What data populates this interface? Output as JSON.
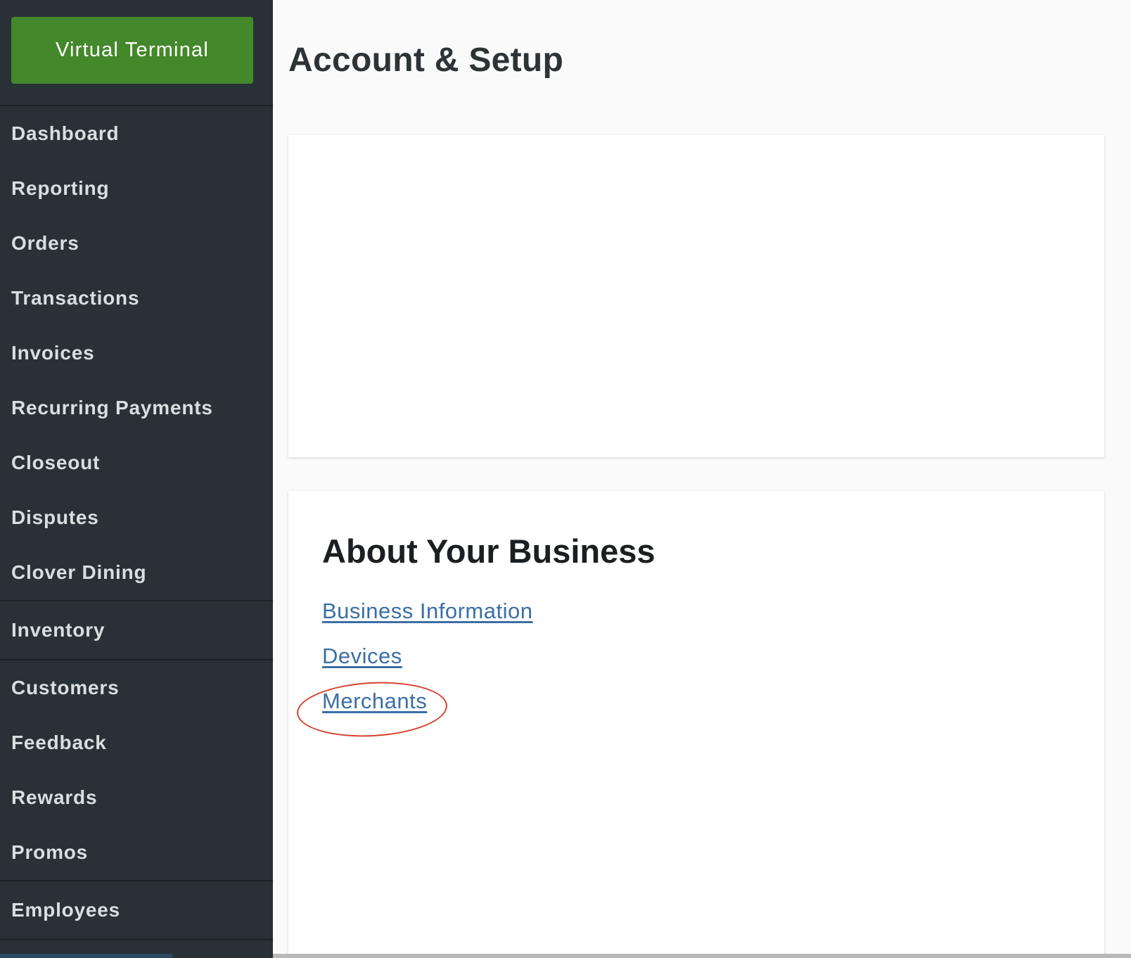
{
  "sidebar": {
    "virtual_terminal_label": "Virtual Terminal",
    "group_1": [
      "Dashboard",
      "Reporting",
      "Orders",
      "Transactions",
      "Invoices",
      "Recurring Payments",
      "Closeout",
      "Disputes",
      "Clover Dining"
    ],
    "inventory_label": "Inventory",
    "group_2": [
      "Customers",
      "Feedback",
      "Rewards",
      "Promos"
    ],
    "employees_label": "Employees"
  },
  "main": {
    "title": "Account & Setup",
    "about": {
      "title": "About Your Business",
      "links": [
        "Business Information",
        "Devices",
        "Merchants"
      ]
    }
  },
  "colors": {
    "sidebar_bg": "#283236",
    "primary_button": "#43882a",
    "link": "#3b6ea5",
    "annotation": "#d8402c"
  }
}
